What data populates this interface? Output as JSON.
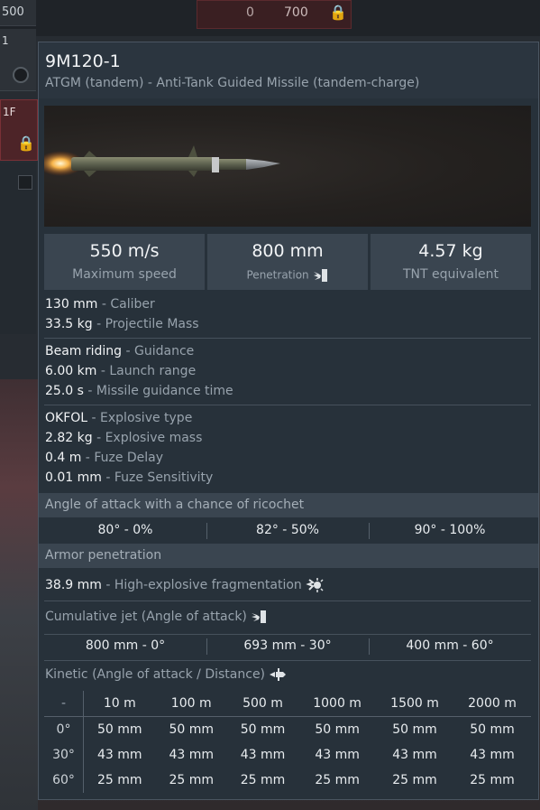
{
  "background": {
    "top_left_value": "500",
    "card_value_zero": "0",
    "card_value_price": "700",
    "card_c_label": "1",
    "card_d_label": "1F"
  },
  "header": {
    "title": "9M120-1",
    "subtitle": "ATGM (tandem) - Anti-Tank Guided Missile (tandem-charge)"
  },
  "stats": [
    {
      "value": "550 m/s",
      "label": "Maximum speed"
    },
    {
      "value": "800 mm",
      "label": "Penetration"
    },
    {
      "value": "4.57 kg",
      "label": "TNT equivalent"
    }
  ],
  "specs": {
    "group1": [
      {
        "value": "130 mm",
        "label": "Caliber"
      },
      {
        "value": "33.5 kg",
        "label": "Projectile Mass"
      }
    ],
    "group2": [
      {
        "value": "Beam riding",
        "label": "Guidance"
      },
      {
        "value": "6.00 km",
        "label": "Launch range"
      },
      {
        "value": "25.0 s",
        "label": "Missile guidance time"
      }
    ],
    "group3": [
      {
        "value": "OKFOL",
        "label": "Explosive type"
      },
      {
        "value": "2.82 kg",
        "label": "Explosive mass"
      },
      {
        "value": "0.4 m",
        "label": "Fuze Delay"
      },
      {
        "value": "0.01 mm",
        "label": "Fuze Sensitivity"
      }
    ]
  },
  "ricochet": {
    "heading": "Angle of attack with a chance of ricochet",
    "values": [
      "80° - 0%",
      "82° - 50%",
      "90° - 100%"
    ]
  },
  "armor": {
    "heading": "Armor penetration",
    "he_frag_value": "38.9 mm",
    "he_frag_label": "High-explosive fragmentation",
    "cumulative_heading": "Cumulative jet (Angle of attack)",
    "cumulative_values": [
      "800 mm - 0°",
      "693 mm - 30°",
      "400 mm - 60°"
    ],
    "kinetic_heading": "Kinetic (Angle of attack / Distance)",
    "kinetic_table": {
      "corner": "-",
      "distances": [
        "10 m",
        "100 m",
        "500 m",
        "1000 m",
        "1500 m",
        "2000 m"
      ],
      "rows": [
        {
          "angle": "0°",
          "values": [
            "50 mm",
            "50 mm",
            "50 mm",
            "50 mm",
            "50 mm",
            "50 mm"
          ]
        },
        {
          "angle": "30°",
          "values": [
            "43 mm",
            "43 mm",
            "43 mm",
            "43 mm",
            "43 mm",
            "43 mm"
          ]
        },
        {
          "angle": "60°",
          "values": [
            "25 mm",
            "25 mm",
            "25 mm",
            "25 mm",
            "25 mm",
            "25 mm"
          ]
        }
      ]
    }
  },
  "colors": {
    "panel_bg": "#27313a",
    "section_bg": "#3a4550",
    "text_primary": "#f1f3f5",
    "text_secondary": "#98a3ad",
    "lock_red": "#e53838"
  },
  "icons": [
    "silver-lion-icon",
    "lock-icon",
    "penetration-icon",
    "he-frag-icon",
    "cumulative-icon",
    "kinetic-icon"
  ]
}
